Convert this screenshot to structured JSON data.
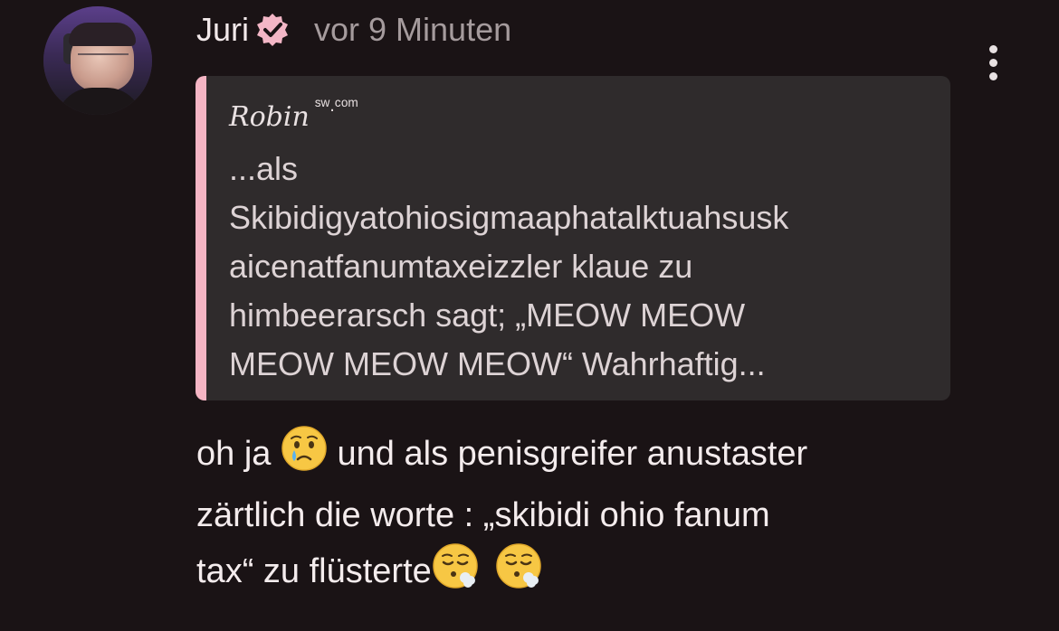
{
  "post": {
    "author": {
      "name": "Juri",
      "verified": true,
      "avatar_alt": "user avatar"
    },
    "timestamp": "vor 9 Minuten",
    "quote": {
      "author": "Robin",
      "author_suffix": "ˢʷ.ᶜᵒᵐ",
      "text": "...als\nSkibidigyatohiosigmaaphatalktuahsusk\naicenatfanumtaxeizzler klaue zu\nhimbeerarsch sagt; „MEOW MEOW\nMEOW MEOW MEOW“ Wahrhaftig..."
    },
    "message": {
      "line1_a": "oh ja",
      "line1_b": "und als penisgreifer anustaster",
      "line2": "zärtlich die worte : „skibidi ohio fanum",
      "line3": "tax“ zu flüsterte"
    }
  },
  "icons": {
    "verified": "verified-badge-icon",
    "more": "more-options-icon",
    "emoji_cry": "crying-face-emoji",
    "emoji_exhale": "face-exhaling-emoji"
  },
  "colors": {
    "background": "#1a1315",
    "quote_background": "#2f2b2c",
    "quote_bar": "#f5b5c4",
    "verified_badge": "#f3b6c6",
    "timestamp": "#a59b9d",
    "text": "#f4eced"
  }
}
